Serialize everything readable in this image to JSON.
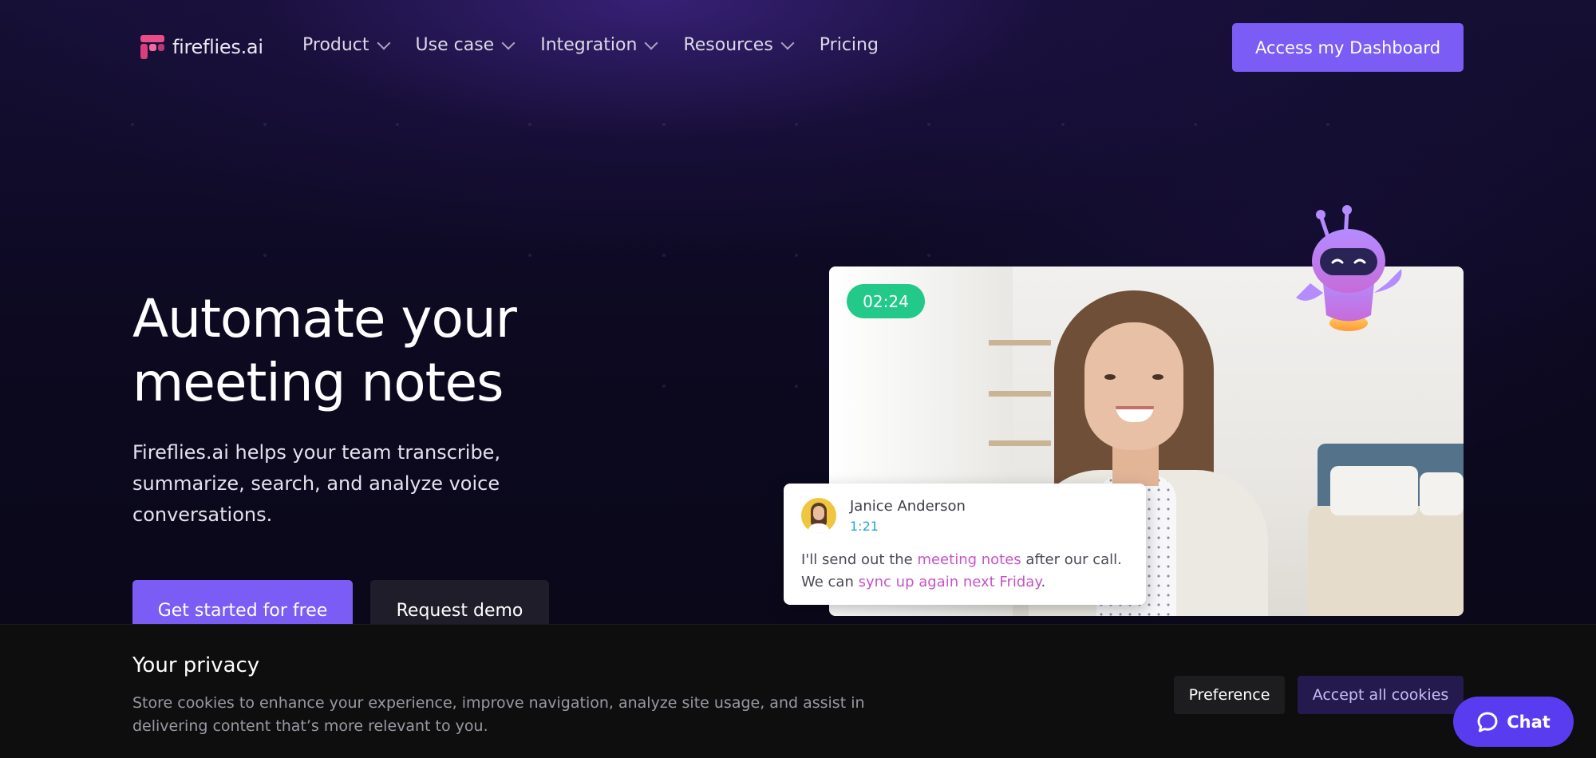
{
  "nav": {
    "logo_text": "fireflies.ai",
    "menu": [
      {
        "label": "Product",
        "has_dropdown": true
      },
      {
        "label": "Use case",
        "has_dropdown": true
      },
      {
        "label": "Integration",
        "has_dropdown": true
      },
      {
        "label": "Resources",
        "has_dropdown": true
      },
      {
        "label": "Pricing",
        "has_dropdown": false
      }
    ],
    "dashboard_button": "Access my Dashboard"
  },
  "hero": {
    "title_line1": "Automate your",
    "title_line2": "meeting notes",
    "subtitle": "Fireflies.ai helps your team transcribe, summarize, search, and analyze voice conversations.",
    "primary_button": "Get started for free",
    "secondary_button": "Request demo"
  },
  "video": {
    "timer": "02:24",
    "transcript": {
      "speaker": "Janice Anderson",
      "time": "1:21",
      "text_part1": "I'll send out the ",
      "highlight1": "meeting notes",
      "text_part2": " after our call. We can ",
      "highlight2": "sync up again next Friday",
      "text_part3": "."
    }
  },
  "cookie": {
    "title": "Your privacy",
    "text": "Store cookies to enhance your experience, improve navigation, analyze site usage, and assist in delivering content that’s more relevant to you.",
    "preference_button": "Preference",
    "accept_button": "Accept all cookies"
  },
  "chat": {
    "label": "Chat"
  },
  "colors": {
    "accent": "#7b5cf5",
    "background": "#0b0819",
    "timer_green": "#22c989",
    "highlight_pink": "#c653c7",
    "chat_button": "#5a3cf0"
  },
  "icons": {
    "logo": "fireflies-logo-icon",
    "dropdown": "chevron-down-icon",
    "chat": "chat-bubble-icon",
    "robot": "robot-mascot-icon"
  }
}
